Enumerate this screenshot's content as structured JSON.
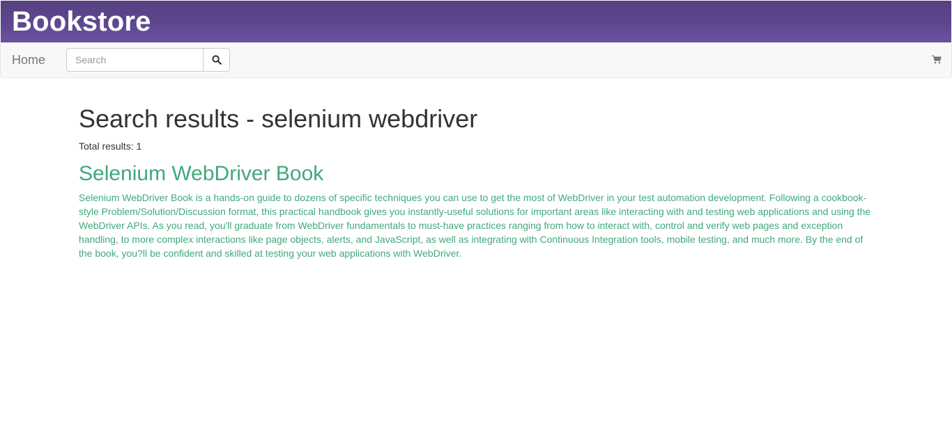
{
  "header": {
    "title": "Bookstore",
    "background_color": "#5f4790"
  },
  "navbar": {
    "home_label": "Home",
    "search": {
      "placeholder": "Search",
      "value": "",
      "button_icon": "search-icon"
    },
    "cart_icon": "shopping-cart-icon"
  },
  "results": {
    "title": "Search results - selenium webdriver",
    "total_text": "Total results: 1",
    "items": [
      {
        "title": "Selenium WebDriver Book",
        "description": "Selenium WebDriver Book is a hands-on guide to dozens of specific techniques you can use to get the most of WebDriver in your test automation development. Following a cookbook-style Problem/Solution/Discussion format, this practical handbook gives you instantly-useful solutions for important areas like interacting with and testing web applications and using the WebDriver APIs. As you read, you'll graduate from WebDriver fundamentals to must-have practices ranging from how to interact with, control and verify web pages and exception handling, to more complex interactions like page objects, alerts, and JavaScript, as well as integrating with Continuous Integration tools, mobile testing, and much more. By the end of the book, you?ll be confident and skilled at testing your web applications with WebDriver."
      }
    ]
  },
  "colors": {
    "link": "#41a87b",
    "text": "#333333",
    "navbar_bg": "#f8f8f8"
  }
}
